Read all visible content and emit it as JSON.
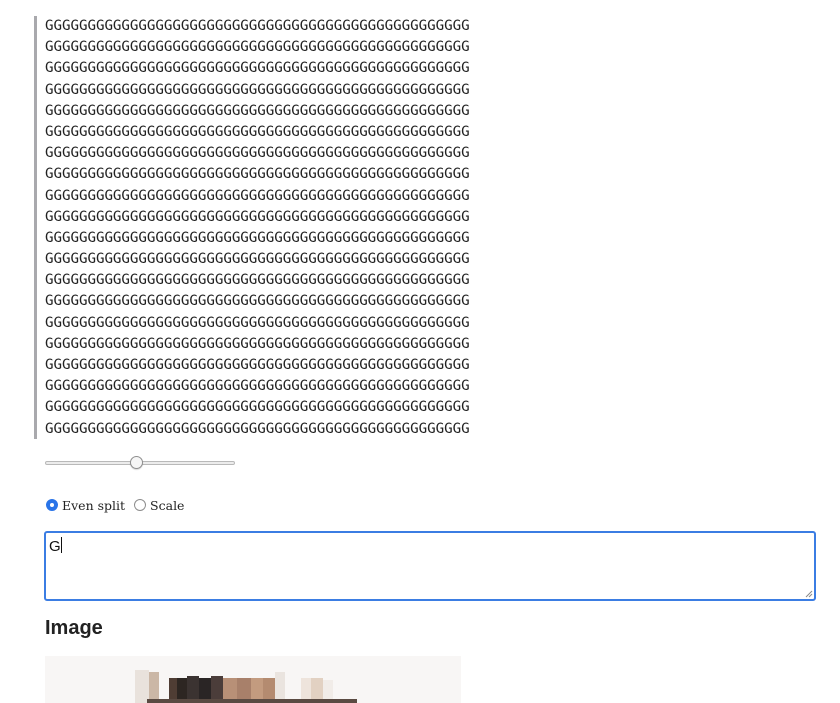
{
  "ascii_art": {
    "lines": [
      "GGGGGGGGGGGGGGGGGGGGGGGGGGGGGGGGGGGGGGGGGGGGGGGGGG",
      "GGGGGGGGGGGGGGGGGGGGGGGGGGGGGGGGGGGGGGGGGGGGGGGGGG",
      "GGGGGGGGGGGGGGGGGGGGGGGGGGGGGGGGGGGGGGGGGGGGGGGGGG",
      "GGGGGGGGGGGGGGGGGGGGGGGGGGGGGGGGGGGGGGGGGGGGGGGGGG",
      "GGGGGGGGGGGGGGGGGGGGGGGGGGGGGGGGGGGGGGGGGGGGGGGGGG",
      "GGGGGGGGGGGGGGGGGGGGGGGGGGGGGGGGGGGGGGGGGGGGGGGGGG",
      "GGGGGGGGGGGGGGGGGGGGGGGGGGGGGGGGGGGGGGGGGGGGGGGGGG",
      "GGGGGGGGGGGGGGGGGGGGGGGGGGGGGGGGGGGGGGGGGGGGGGGGGG",
      "GGGGGGGGGGGGGGGGGGGGGGGGGGGGGGGGGGGGGGGGGGGGGGGGGG",
      "GGGGGGGGGGGGGGGGGGGGGGGGGGGGGGGGGGGGGGGGGGGGGGGGGG",
      "GGGGGGGGGGGGGGGGGGGGGGGGGGGGGGGGGGGGGGGGGGGGGGGGGG",
      "GGGGGGGGGGGGGGGGGGGGGGGGGGGGGGGGGGGGGGGGGGGGGGGGGG",
      "GGGGGGGGGGGGGGGGGGGGGGGGGGGGGGGGGGGGGGGGGGGGGGGGGG",
      "GGGGGGGGGGGGGGGGGGGGGGGGGGGGGGGGGGGGGGGGGGGGGGGGGG",
      "GGGGGGGGGGGGGGGGGGGGGGGGGGGGGGGGGGGGGGGGGGGGGGGGGG",
      "GGGGGGGGGGGGGGGGGGGGGGGGGGGGGGGGGGGGGGGGGGGGGGGGGG",
      "GGGGGGGGGGGGGGGGGGGGGGGGGGGGGGGGGGGGGGGGGGGGGGGGGG",
      "GGGGGGGGGGGGGGGGGGGGGGGGGGGGGGGGGGGGGGGGGGGGGGGGGG",
      "GGGGGGGGGGGGGGGGGGGGGGGGGGGGGGGGGGGGGGGGGGGGGGGGGG",
      "GGGGGGGGGGGGGGGGGGGGGGGGGGGGGGGGGGGGGGGGGGGGGGGGGG"
    ]
  },
  "slider": {
    "value_fraction": 0.48
  },
  "mode": {
    "options": [
      {
        "label": "Even split",
        "checked": true
      },
      {
        "label": "Scale",
        "checked": false
      }
    ]
  },
  "text_input": {
    "value": "G"
  },
  "image_section": {
    "heading": "Image"
  },
  "colors": {
    "accent": "#2a74e8",
    "border_bar": "#a9a9ad"
  }
}
